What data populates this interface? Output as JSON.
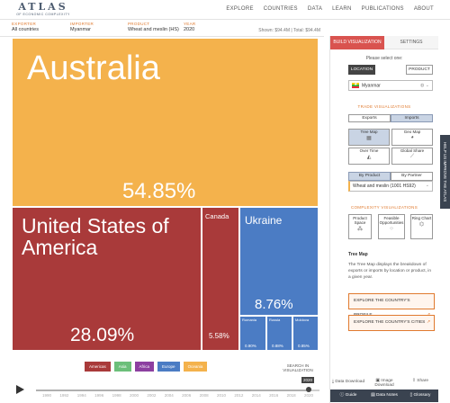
{
  "logo": {
    "main": "ATLAS",
    "sub": "OF ECONOMIC COMPLEXITY"
  },
  "nav": [
    "EXPLORE",
    "COUNTRIES",
    "DATA",
    "LEARN",
    "PUBLICATIONS",
    "ABOUT"
  ],
  "selectors": {
    "exporter": {
      "label": "EXPORTER",
      "value": "All countries"
    },
    "importer": {
      "label": "IMPORTER",
      "value": "Myanmar"
    },
    "product": {
      "label": "PRODUCT",
      "value": "Wheat and meslin (HS)"
    },
    "year": {
      "label": "YEAR",
      "value": "2020"
    },
    "shown": "Shown:  $94.4M  |  Total:  $94.4M"
  },
  "treemap": [
    {
      "name": "Australia",
      "pct": "54.85%",
      "color": "#f4b24c"
    },
    {
      "name": "United States of America",
      "pct": "28.09%",
      "color": "#a93a3a"
    },
    {
      "name": "Canada",
      "pct": "5.58%",
      "color": "#a93a3a"
    },
    {
      "name": "Ukraine",
      "pct": "8.76%",
      "color": "#4b7cc4"
    },
    {
      "name": "Romania",
      "pct": "0.90%",
      "color": "#4b7cc4"
    },
    {
      "name": "Russia",
      "pct": "0.88%",
      "color": "#4b7cc4"
    },
    {
      "name": "Moldova",
      "pct": "0.85%",
      "color": "#4b7cc4"
    }
  ],
  "legend": [
    {
      "label": "Americas",
      "color": "#a93a3a"
    },
    {
      "label": "Asia",
      "color": "#6cbf7a"
    },
    {
      "label": "Africa",
      "color": "#8c3fa0"
    },
    {
      "label": "Europe",
      "color": "#4b7cc4"
    },
    {
      "label": "Oceania",
      "color": "#f4b24c"
    }
  ],
  "search_viz": "SEARCH IN VISUALIZATION",
  "timeline": {
    "years": [
      "1990",
      "1992",
      "1994",
      "1996",
      "1998",
      "2000",
      "2002",
      "2004",
      "2006",
      "2008",
      "2010",
      "2012",
      "2014",
      "2016",
      "2018",
      "2020"
    ],
    "selected": "2020",
    "fill_fraction": 1.0
  },
  "sidebar": {
    "tabs": [
      "BUILD VISUALIZATION",
      "SETTINGS"
    ],
    "prompt": "Please select one:",
    "location_label": "LOCATION",
    "product_label": "PRODUCT",
    "country": "Myanmar",
    "trade_section": "TRADE VISUALIZATIONS",
    "exports": "Exports",
    "imports": "Imports",
    "tree_map": "Tree Map",
    "geo_map": "Geo Map",
    "over_time": "Over Time",
    "global_share": "Global Share",
    "by_product": "By Product",
    "by_partner": "By Partner",
    "product_field": "Wheat and meslin (1001 HS92)",
    "complexity_section": "COMPLEXITY VISUALIZATIONS",
    "product_space": "Product Space",
    "feasible": "Feasible Opportunities",
    "ring_chart": "Ring Chart",
    "desc_title": "Tree Map",
    "desc": "The Tree Map displays the breakdown of exports or imports by location or product, in a given year.",
    "explore_profile": "EXPLORE THE COUNTRY'S PROFILE",
    "explore_cities": "EXPLORE THE COUNTRY'S CITIES",
    "footer": [
      "Data Download",
      "Image Download",
      "Share"
    ],
    "bottom": [
      "Guide",
      "Data Notes",
      "Glossary"
    ],
    "help": "HELP US IMPROVE THE ATLAS"
  }
}
